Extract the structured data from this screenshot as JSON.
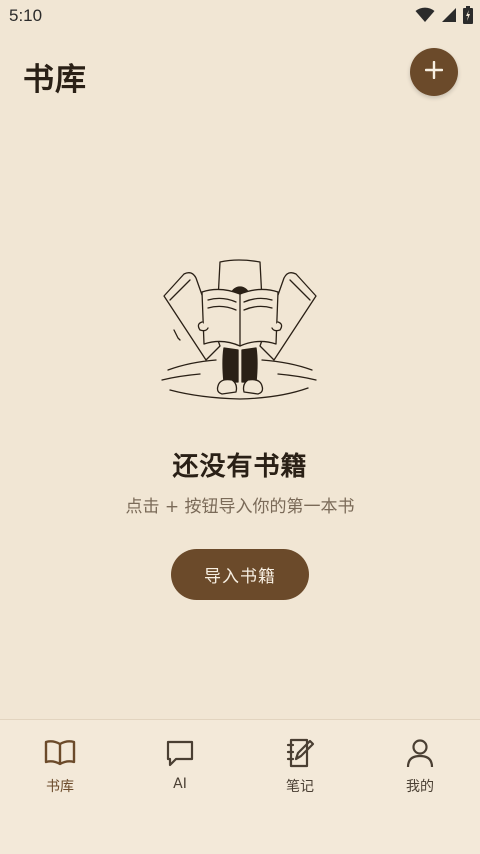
{
  "status_bar": {
    "time": "5:10",
    "icons": [
      "wifi-icon",
      "signal-icon",
      "battery-icon"
    ]
  },
  "header": {
    "title": "书库",
    "add_icon": "plus-icon"
  },
  "empty_state": {
    "title": "还没有书籍",
    "subtitle": "点击 + 按钮导入你的第一本书",
    "button_label": "导入书籍"
  },
  "bottom_nav": {
    "items": [
      {
        "label": "书库",
        "icon": "book-open-icon",
        "active": true
      },
      {
        "label": "AI",
        "icon": "chat-bubble-icon",
        "active": false
      },
      {
        "label": "笔记",
        "icon": "notebook-edit-icon",
        "active": false
      },
      {
        "label": "我的",
        "icon": "person-icon",
        "active": false
      }
    ]
  },
  "colors": {
    "background": "#f1e6d4",
    "accent": "#6b4a2a",
    "text_primary": "#2a2016",
    "text_secondary": "#7a6a58"
  }
}
